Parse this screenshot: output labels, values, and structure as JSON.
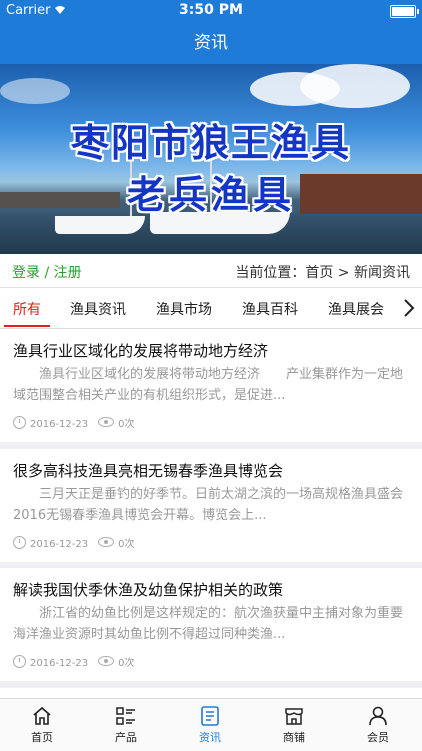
{
  "status": {
    "carrier": "Carrier",
    "time": "3:50 PM"
  },
  "navbar": {
    "title": "资讯"
  },
  "banner": {
    "line1": "枣阳市狼王渔具",
    "line2": "老兵渔具"
  },
  "loginbar": {
    "login": "登录 / 注册",
    "breadcrumb": "当前位置：首页 > 新闻资讯"
  },
  "tabs": [
    {
      "label": "所有",
      "active": true
    },
    {
      "label": "渔具资讯"
    },
    {
      "label": "渔具市场"
    },
    {
      "label": "渔具百科"
    },
    {
      "label": "渔具展会"
    }
  ],
  "articles": [
    {
      "title": "渔具行业区域化的发展将带动地方经济",
      "summary": "渔具行业区域化的发展将带动地方经济　　产业集群作为一定地域范围整合相关产业的有机组织形式，是促进...",
      "date": "2016-12-23",
      "views": "0次"
    },
    {
      "title": "很多高科技渔具亮相无锡春季渔具博览会",
      "summary": "三月天正是垂钓的好季节。日前太湖之滨的一场高规格渔具盛会2016无锡春季渔具博览会开幕。博览会上...",
      "date": "2016-12-23",
      "views": "0次"
    },
    {
      "title": "解读我国伏季休渔及幼鱼保护相关的政策",
      "summary": "浙江省的幼鱼比例是这样规定的：航次渔获量中主捕对象为重要海洋渔业资源时其幼鱼比例不得超过同种类渔...",
      "date": "2016-12-23",
      "views": "0次"
    }
  ],
  "tabbar": [
    {
      "label": "首页",
      "icon": "home-icon"
    },
    {
      "label": "产品",
      "icon": "grid-list-icon"
    },
    {
      "label": "资讯",
      "icon": "document-icon",
      "active": true
    },
    {
      "label": "商铺",
      "icon": "store-icon"
    },
    {
      "label": "会员",
      "icon": "user-icon"
    }
  ],
  "colors": {
    "primary": "#1f7bd8",
    "tab_active": "#e02020",
    "login": "#2aa02a"
  }
}
